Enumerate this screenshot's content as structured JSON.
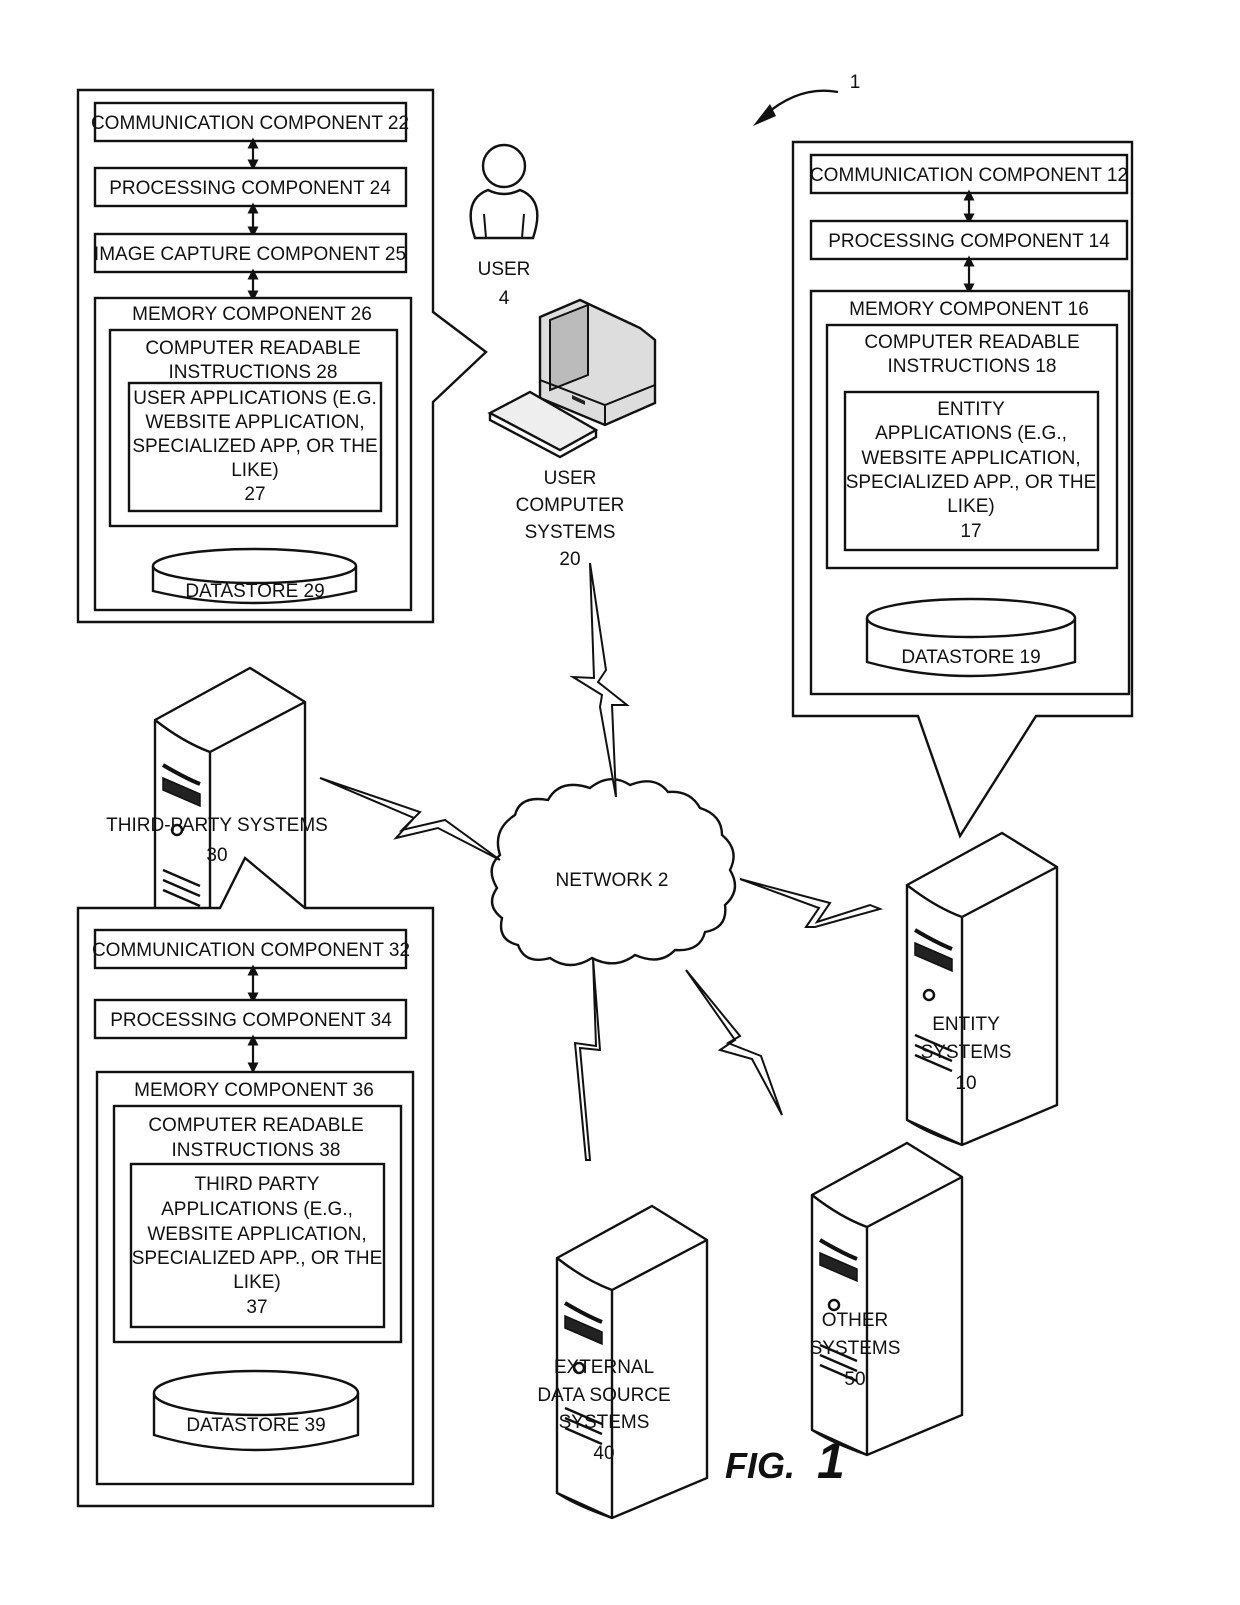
{
  "figure": {
    "label_prefix": "FIG.",
    "label_number": "1",
    "system_ref": "1"
  },
  "network": {
    "label": "NETWORK 2"
  },
  "user": {
    "label": "USER",
    "ref": "4"
  },
  "user_computer_systems": {
    "lines": [
      "USER",
      "COMPUTER",
      "SYSTEMS"
    ],
    "ref": "20"
  },
  "third_party_systems": {
    "label": "THIRD-PARTY SYSTEMS",
    "ref": "30"
  },
  "entity_systems": {
    "lines": [
      "ENTITY",
      "SYSTEMS"
    ],
    "ref": "10"
  },
  "external_data_source_systems": {
    "lines": [
      "EXTERNAL",
      "DATA SOURCE",
      "SYSTEMS"
    ],
    "ref": "40"
  },
  "other_systems": {
    "lines": [
      "OTHER",
      "SYSTEMS"
    ],
    "ref": "50"
  },
  "user_computer_detail": {
    "communication": "COMMUNICATION COMPONENT 22",
    "processing": "PROCESSING COMPONENT 24",
    "image_capture": "IMAGE CAPTURE COMPONENT 25",
    "memory": "MEMORY COMPONENT 26",
    "instructions": [
      "COMPUTER READABLE",
      "INSTRUCTIONS 28"
    ],
    "applications": [
      "USER APPLICATIONS (E.G.",
      "WEBSITE APPLICATION,",
      "SPECIALIZED APP, OR THE",
      "LIKE)",
      "27"
    ],
    "datastore": "DATASTORE 29"
  },
  "entity_detail": {
    "communication": "COMMUNICATION COMPONENT 12",
    "processing": "PROCESSING COMPONENT  14",
    "memory": "MEMORY COMPONENT  16",
    "instructions": [
      "COMPUTER READABLE",
      "INSTRUCTIONS 18"
    ],
    "applications": [
      "ENTITY",
      "APPLICATIONS (E.G.,",
      "WEBSITE APPLICATION,",
      "SPECIALIZED APP., OR THE",
      "LIKE)",
      "17"
    ],
    "datastore": "DATASTORE 19"
  },
  "third_party_detail": {
    "communication": "COMMUNICATION COMPONENT 32",
    "processing": "PROCESSING COMPONENT 34",
    "memory": "MEMORY COMPONENT 36",
    "instructions": [
      "COMPUTER READABLE",
      "INSTRUCTIONS 38"
    ],
    "applications": [
      "THIRD PARTY",
      "APPLICATIONS  (E.G.,",
      "WEBSITE APPLICATION,",
      "SPECIALIZED APP., OR THE",
      "LIKE)",
      "37"
    ],
    "datastore": "DATASTORE 39"
  }
}
